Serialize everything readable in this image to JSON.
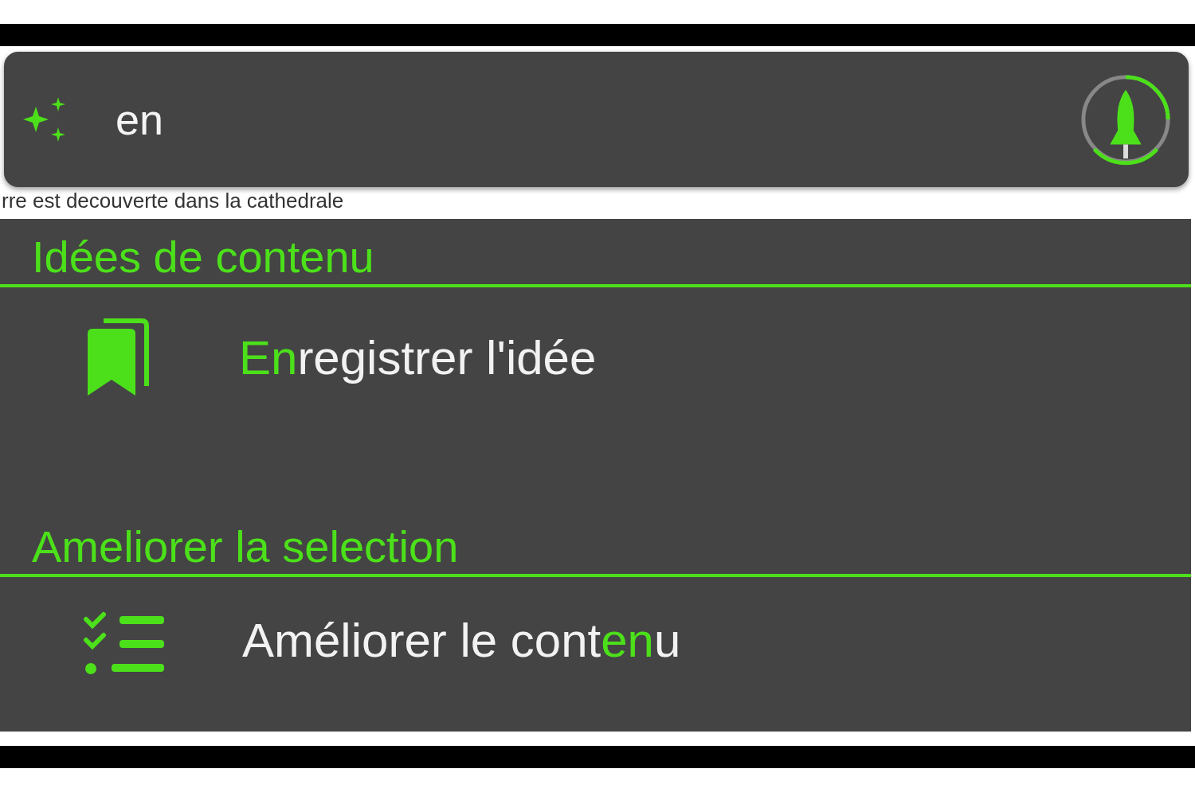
{
  "search": {
    "value": "en"
  },
  "background_text": "rre est decouverte dans la cathedrale",
  "sections": [
    {
      "title": "Idées de contenu",
      "items": [
        {
          "kind": "bookmark",
          "segments": [
            {
              "text": "En",
              "match": true
            },
            {
              "text": "registrer l'idée",
              "match": false
            }
          ]
        }
      ]
    },
    {
      "title": "Ameliorer la selection",
      "items": [
        {
          "kind": "checklist",
          "segments": [
            {
              "text": "Améliorer le cont",
              "match": false
            },
            {
              "text": "en",
              "match": true
            },
            {
              "text": "u",
              "match": false
            }
          ]
        }
      ]
    }
  ]
}
